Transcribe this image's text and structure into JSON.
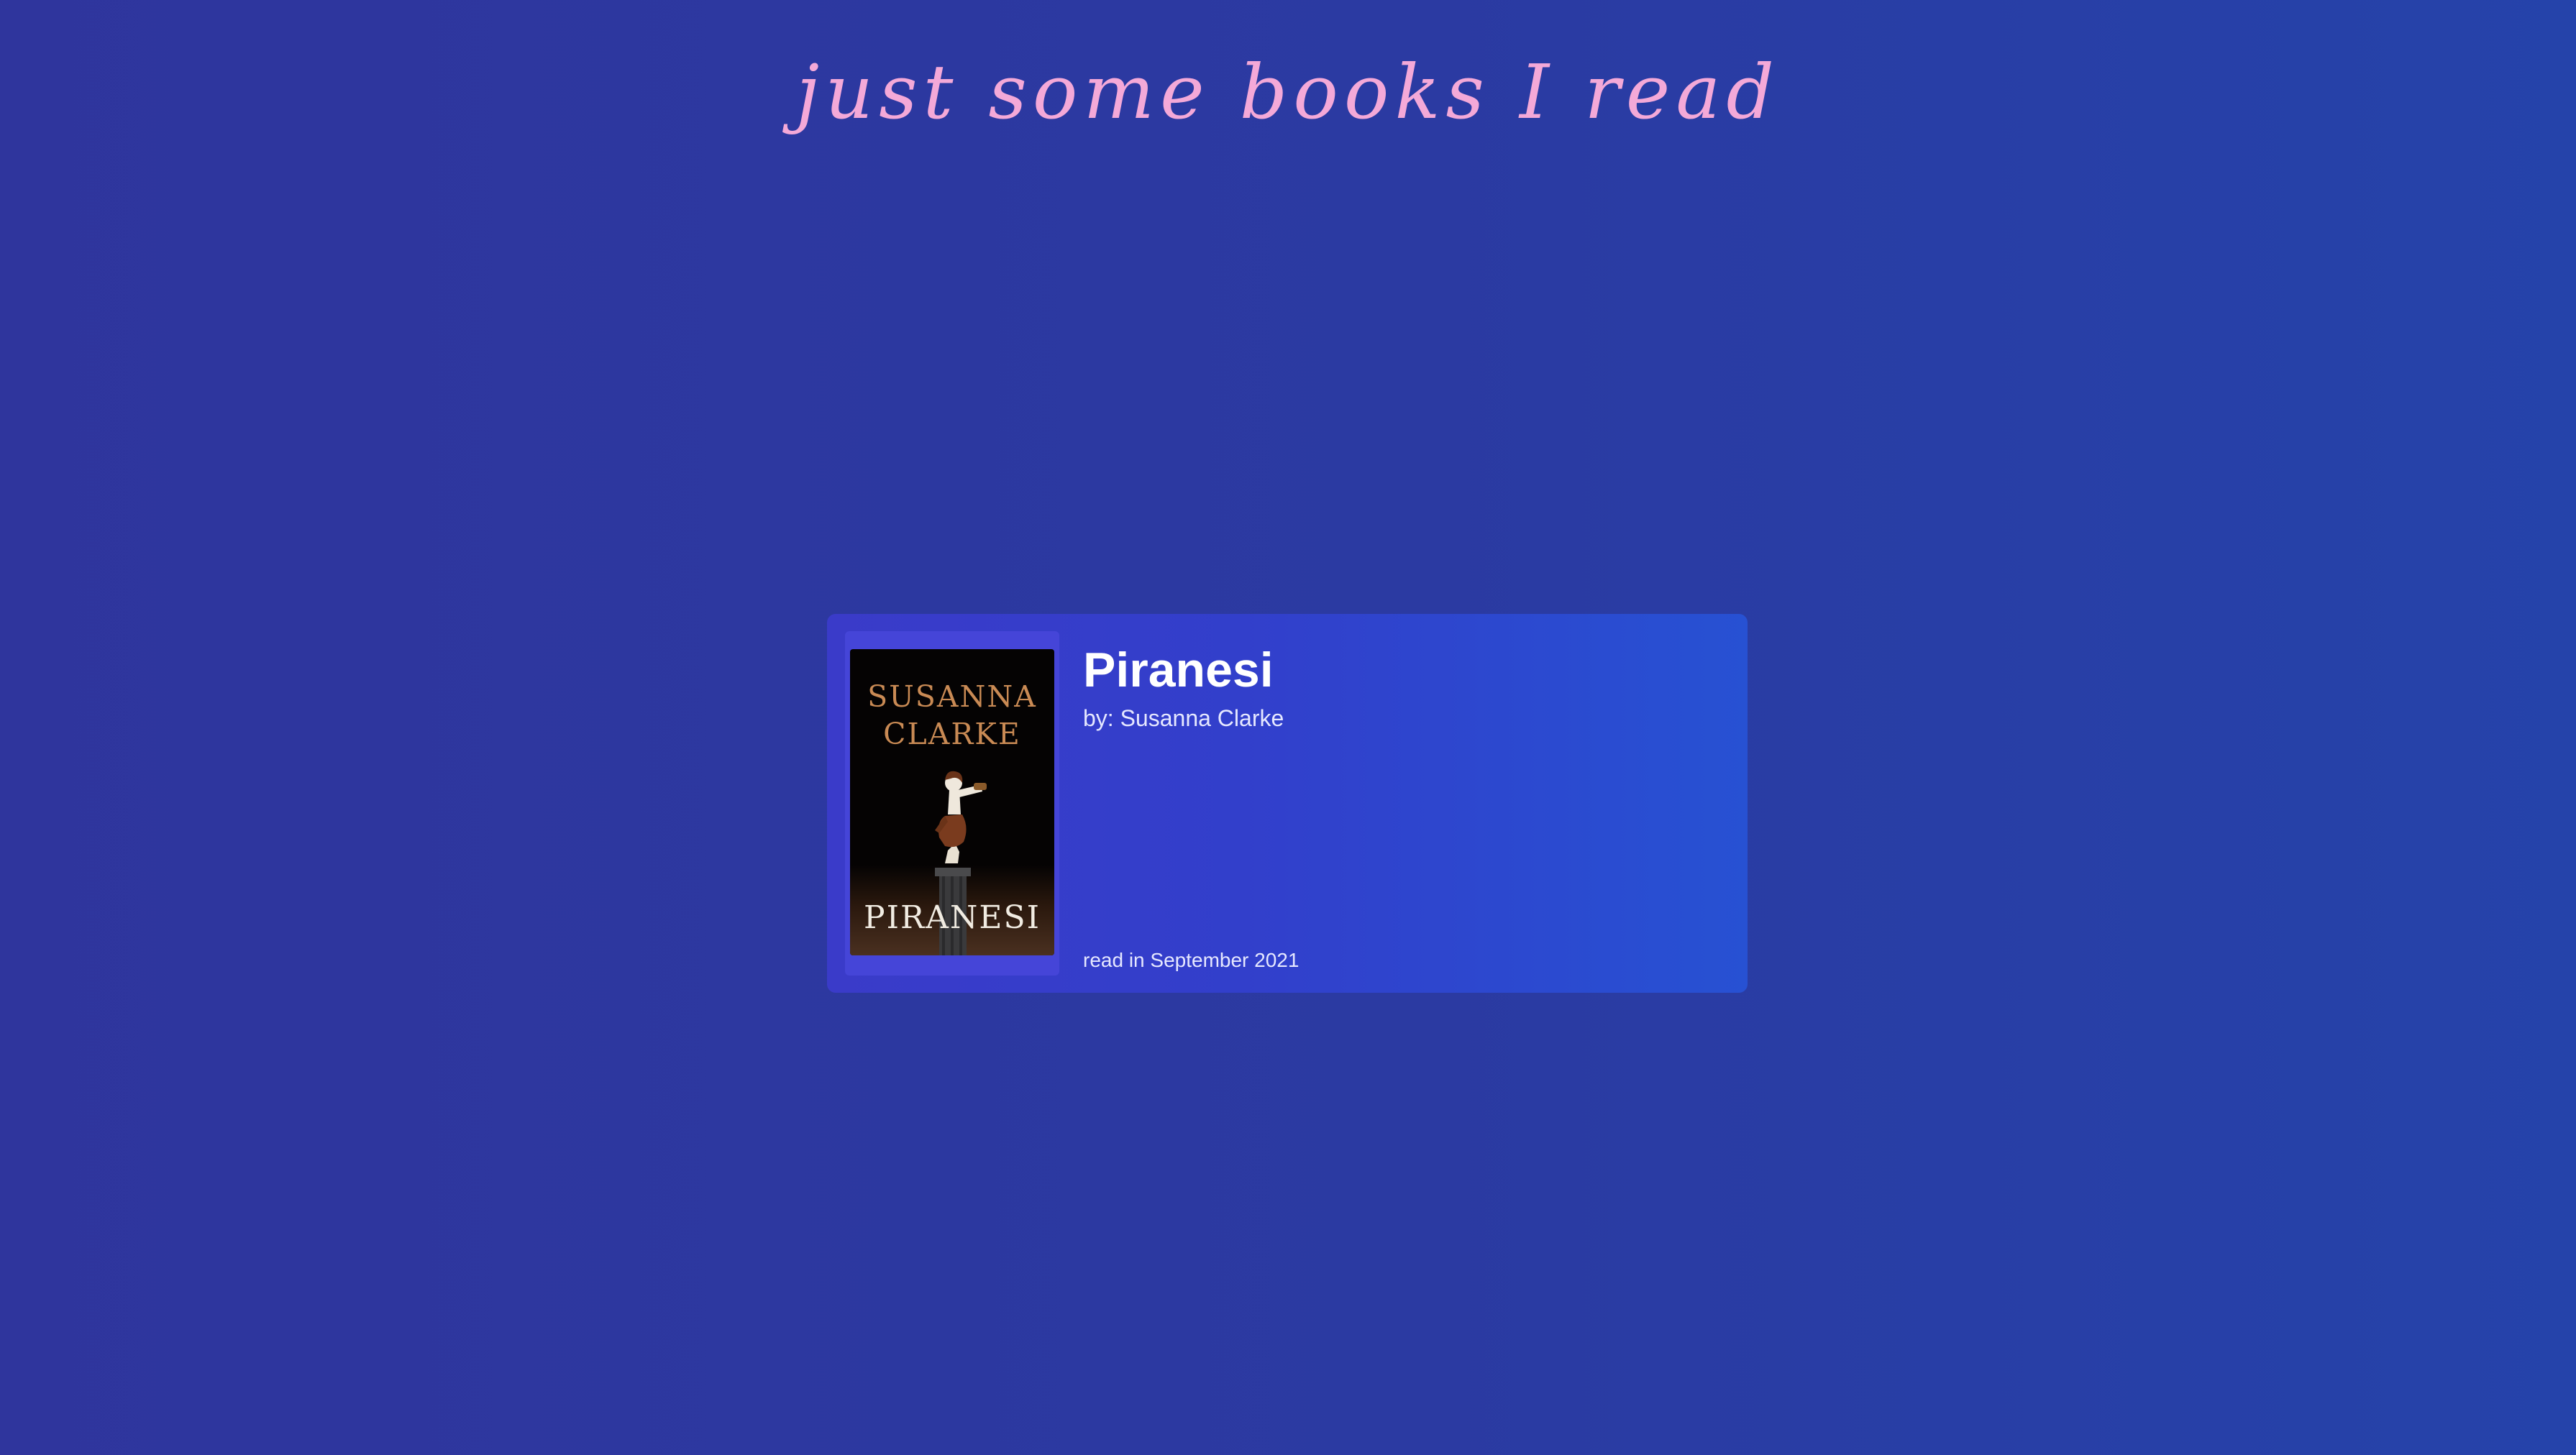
{
  "header": {
    "title": "just some books I read",
    "title_color": "#f4a9d8"
  },
  "book": {
    "title": "Piranesi",
    "author_line": "by: Susanna Clarke",
    "read_line": "read in September 2021",
    "cover": {
      "author_text": "SUSANNA CLARKE",
      "title_text": "PIRANESI",
      "author_color": "#c98a54",
      "background_color": "#050303"
    }
  },
  "colors": {
    "background_left": "#2f359d",
    "background_right": "#2543aa",
    "card_left": "#3a3bc9",
    "card_right": "#2751d3",
    "cover_frame": "#4545d8"
  }
}
